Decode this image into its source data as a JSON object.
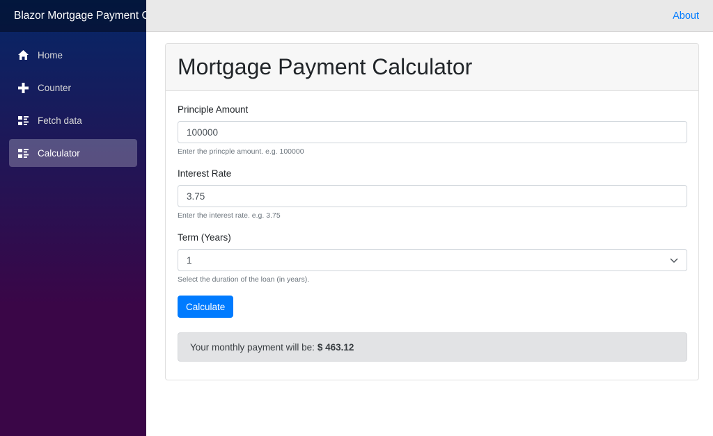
{
  "app": {
    "brand": "Blazor Mortgage Payment Calculator"
  },
  "topbar": {
    "about_label": "About"
  },
  "sidebar": {
    "items": [
      {
        "label": "Home",
        "icon": "home-icon",
        "active": false
      },
      {
        "label": "Counter",
        "icon": "plus-icon",
        "active": false
      },
      {
        "label": "Fetch data",
        "icon": "list-rich-icon",
        "active": false
      },
      {
        "label": "Calculator",
        "icon": "list-rich-icon",
        "active": true
      }
    ]
  },
  "page": {
    "title": "Mortgage Payment Calculator"
  },
  "form": {
    "principal": {
      "label": "Principle Amount",
      "value": "100000",
      "help": "Enter the princple amount. e.g. 100000"
    },
    "interest": {
      "label": "Interest Rate",
      "value": "3.75",
      "help": "Enter the interest rate. e.g. 3.75"
    },
    "term": {
      "label": "Term (Years)",
      "selected": "1",
      "help": "Select the duration of the loan (in years)."
    },
    "calculate_label": "Calculate"
  },
  "result": {
    "prefix": "Your monthly payment will be:",
    "amount": "$ 463.12"
  },
  "colors": {
    "accent": "#007bff",
    "sidebar_top": "#052767",
    "sidebar_bottom": "#3a0647"
  }
}
